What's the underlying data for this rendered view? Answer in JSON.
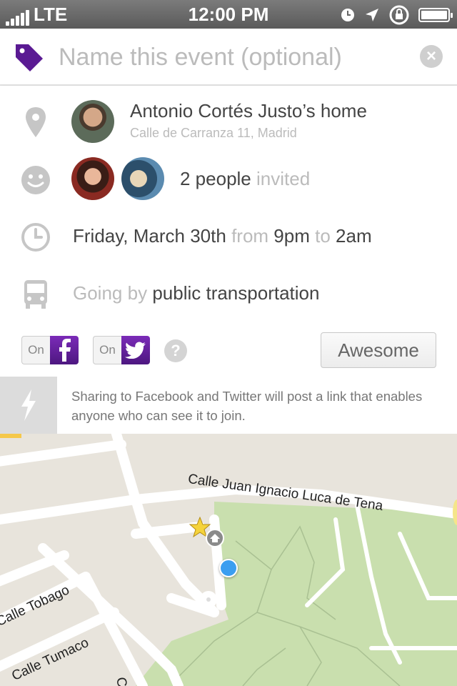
{
  "status_bar": {
    "carrier": "LTE",
    "time": "12:00 PM"
  },
  "event": {
    "name_placeholder": "Name this event (optional)",
    "location": {
      "title": "Antonio Cortés Justo’s home",
      "address": "Calle de Carranza 11, Madrid"
    },
    "people": {
      "count_text": "2 people",
      "suffix": "invited"
    },
    "time": {
      "day": "Friday, March 30th",
      "from_word": "from",
      "start": "9pm",
      "to_word": "to",
      "end": "2am"
    },
    "transport": {
      "prefix": "Going by",
      "mode": "public transportation"
    }
  },
  "sharing": {
    "facebook_toggle": "On",
    "twitter_toggle": "On",
    "help": "?",
    "submit_label": "Awesome",
    "note": "Sharing to Facebook and Twitter will post a link that enables anyone who can see it to join."
  },
  "map": {
    "streets": [
      "Calle Juan Ignacio Luca de Tena",
      "Calle Tobago",
      "Calle Tumaco",
      "Calle"
    ]
  },
  "colors": {
    "accent": "#5a1a93",
    "map_bg": "#e8e4dc",
    "park": "#c9dfae",
    "location_dot": "#3a9ef0"
  }
}
